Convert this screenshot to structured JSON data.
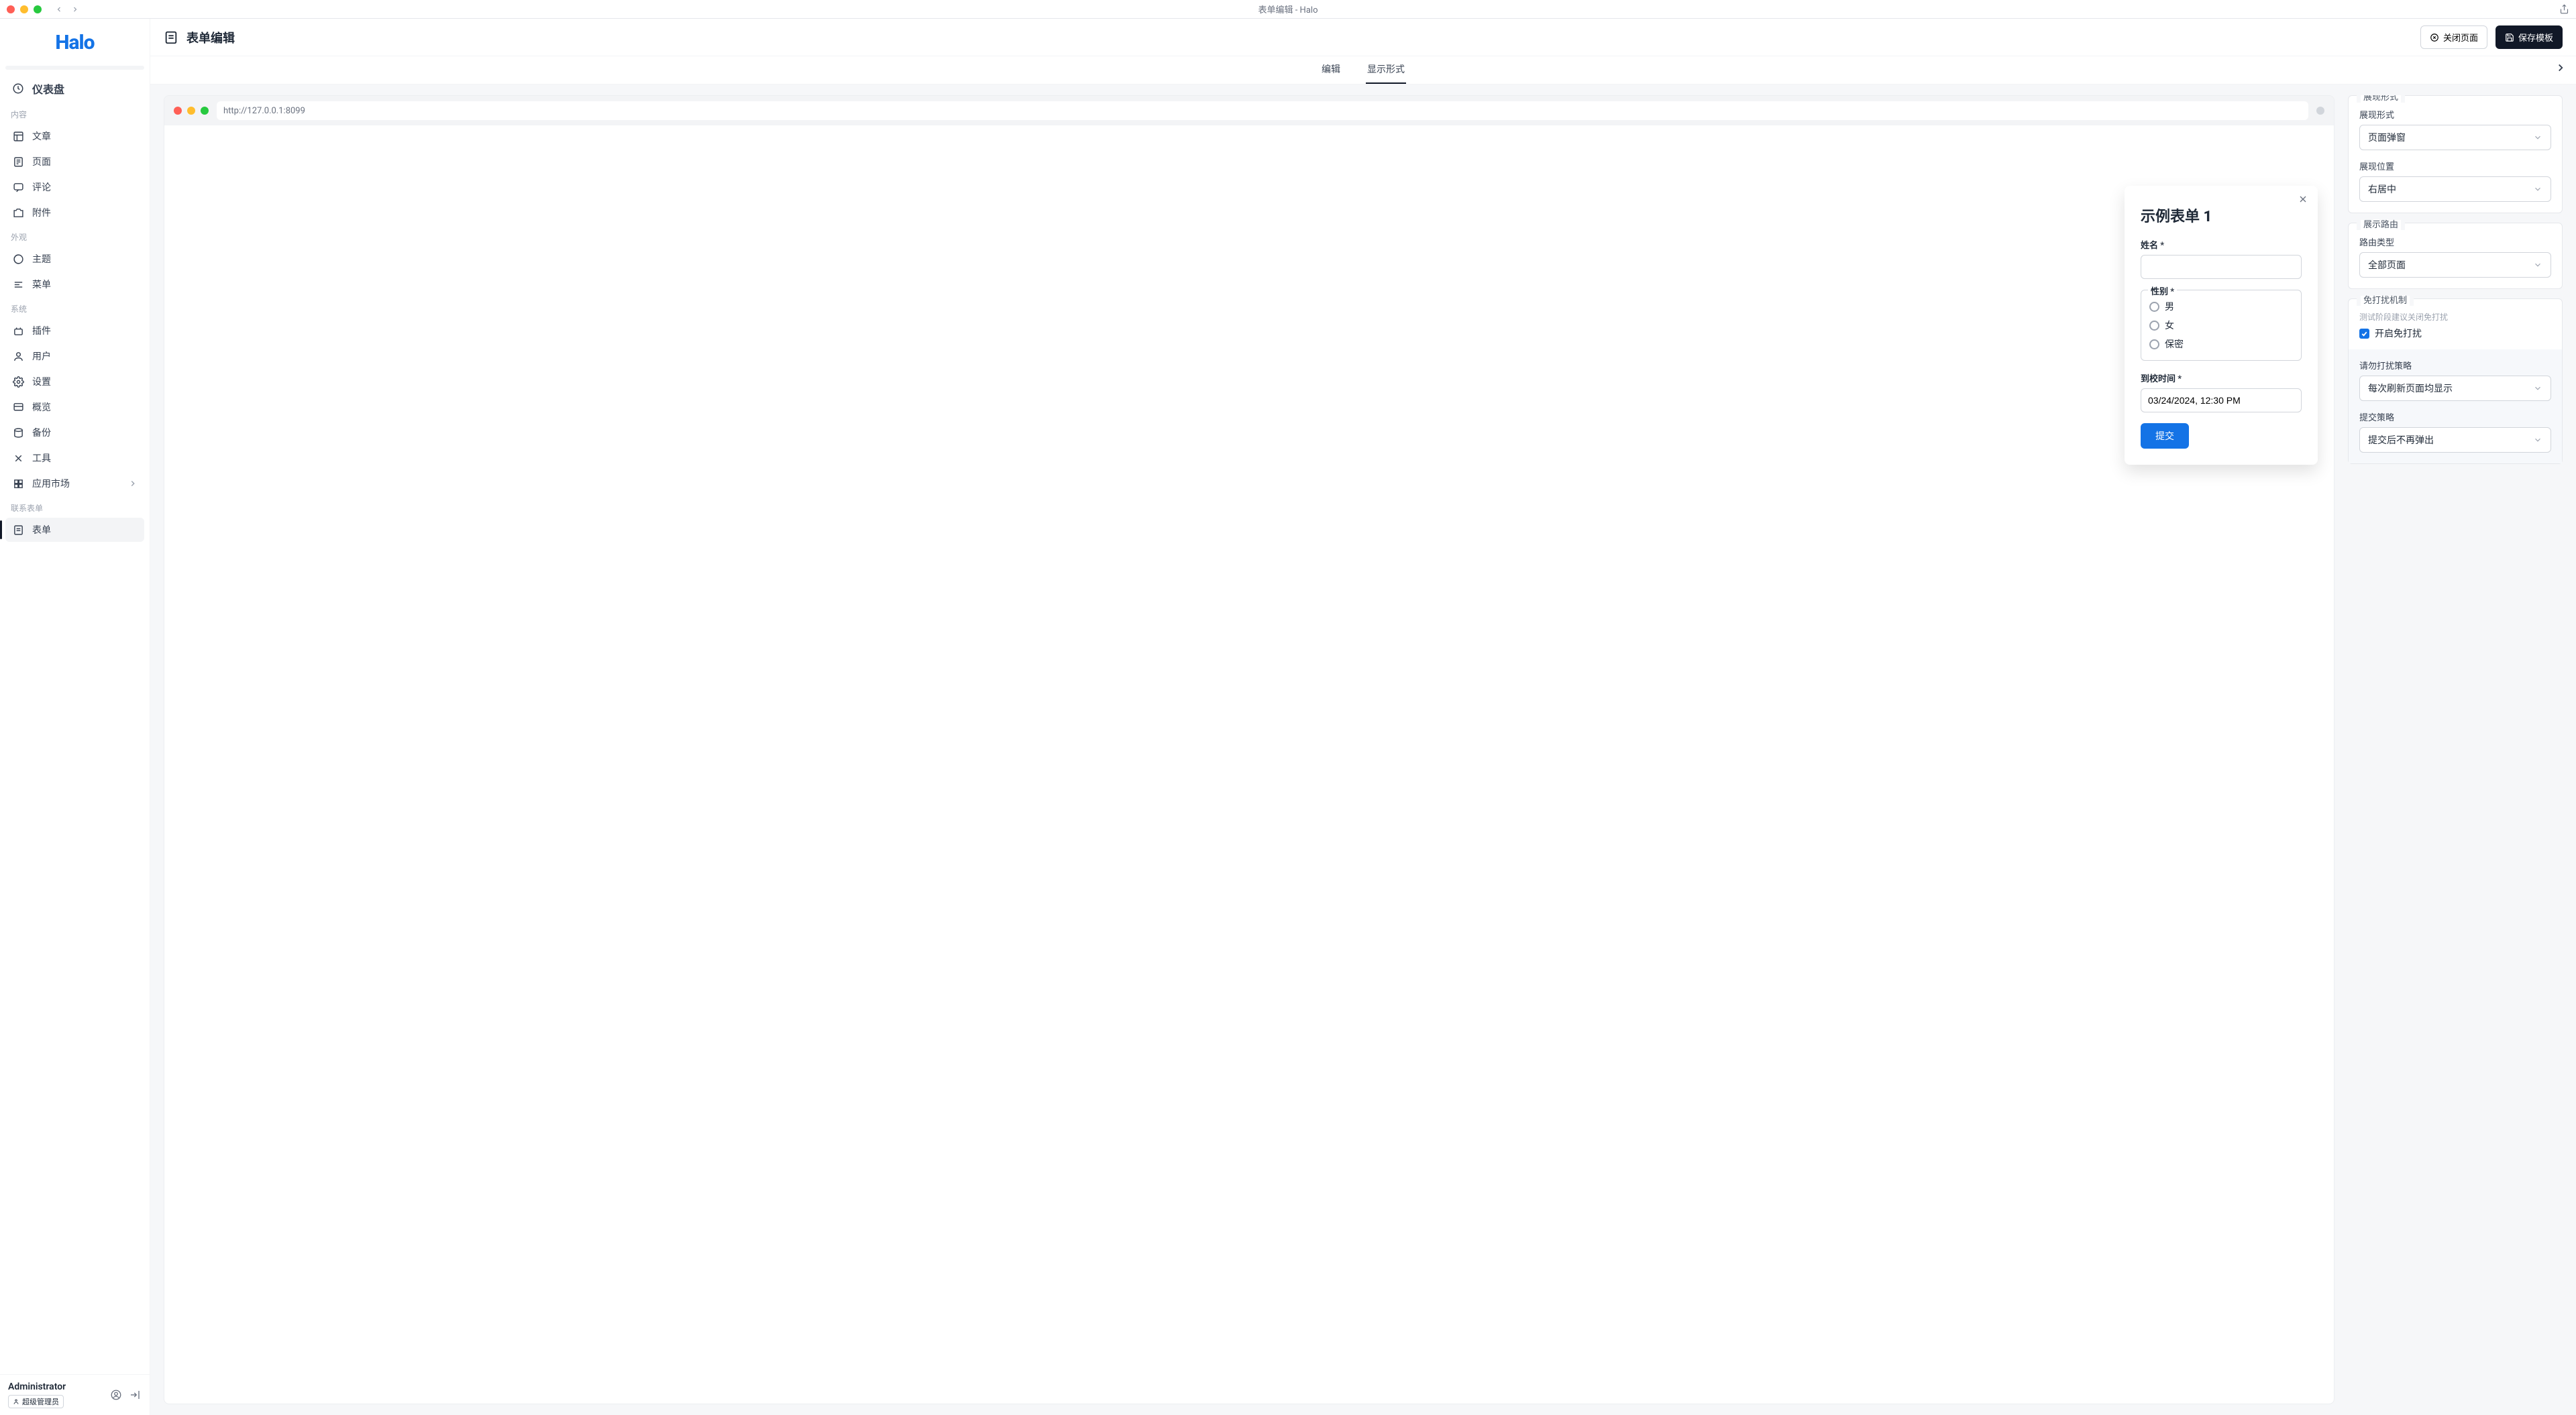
{
  "window": {
    "title": "表单编辑 - Halo"
  },
  "brand": "Halo",
  "sidebar": {
    "dashboard": "仪表盘",
    "groups": {
      "content": {
        "label": "内容",
        "posts": "文章",
        "pages": "页面",
        "comments": "评论",
        "attachments": "附件"
      },
      "appearance": {
        "label": "外观",
        "themes": "主题",
        "menus": "菜单"
      },
      "system": {
        "label": "系统",
        "plugins": "插件",
        "users": "用户",
        "settings": "设置",
        "overview": "概览",
        "backup": "备份",
        "tools": "工具",
        "market": "应用市场"
      },
      "contact": {
        "label": "联系表单",
        "forms": "表单"
      }
    },
    "footer": {
      "name": "Administrator",
      "role": "超级管理员"
    }
  },
  "header": {
    "title": "表单编辑",
    "close": "关闭页面",
    "save": "保存模板",
    "tabs": {
      "edit": "编辑",
      "display": "显示形式"
    }
  },
  "preview": {
    "url": "http://127.0.0.1:8099",
    "form": {
      "title": "示例表单 1",
      "name_label": "姓名 *",
      "gender_legend": "性别 *",
      "gender_options": {
        "male": "男",
        "female": "女",
        "secret": "保密"
      },
      "arrival_label": "到校时间 *",
      "arrival_value": "03/24/2024, 12:30 PM",
      "submit": "提交"
    }
  },
  "panel": {
    "display": {
      "title": "展现形式",
      "mode_label": "展现形式",
      "mode_value": "页面弹窗",
      "position_label": "展现位置",
      "position_value": "右居中"
    },
    "route": {
      "title": "展示路由",
      "type_label": "路由类型",
      "type_value": "全部页面"
    },
    "dnd": {
      "title": "免打扰机制",
      "hint": "测试阶段建议关闭免打扰",
      "checkbox_label": "开启免打扰",
      "policy_label": "请勿打扰策略",
      "policy_value": "每次刷新页面均显示",
      "submit_policy_label": "提交策略",
      "submit_policy_value": "提交后不再弹出"
    }
  }
}
